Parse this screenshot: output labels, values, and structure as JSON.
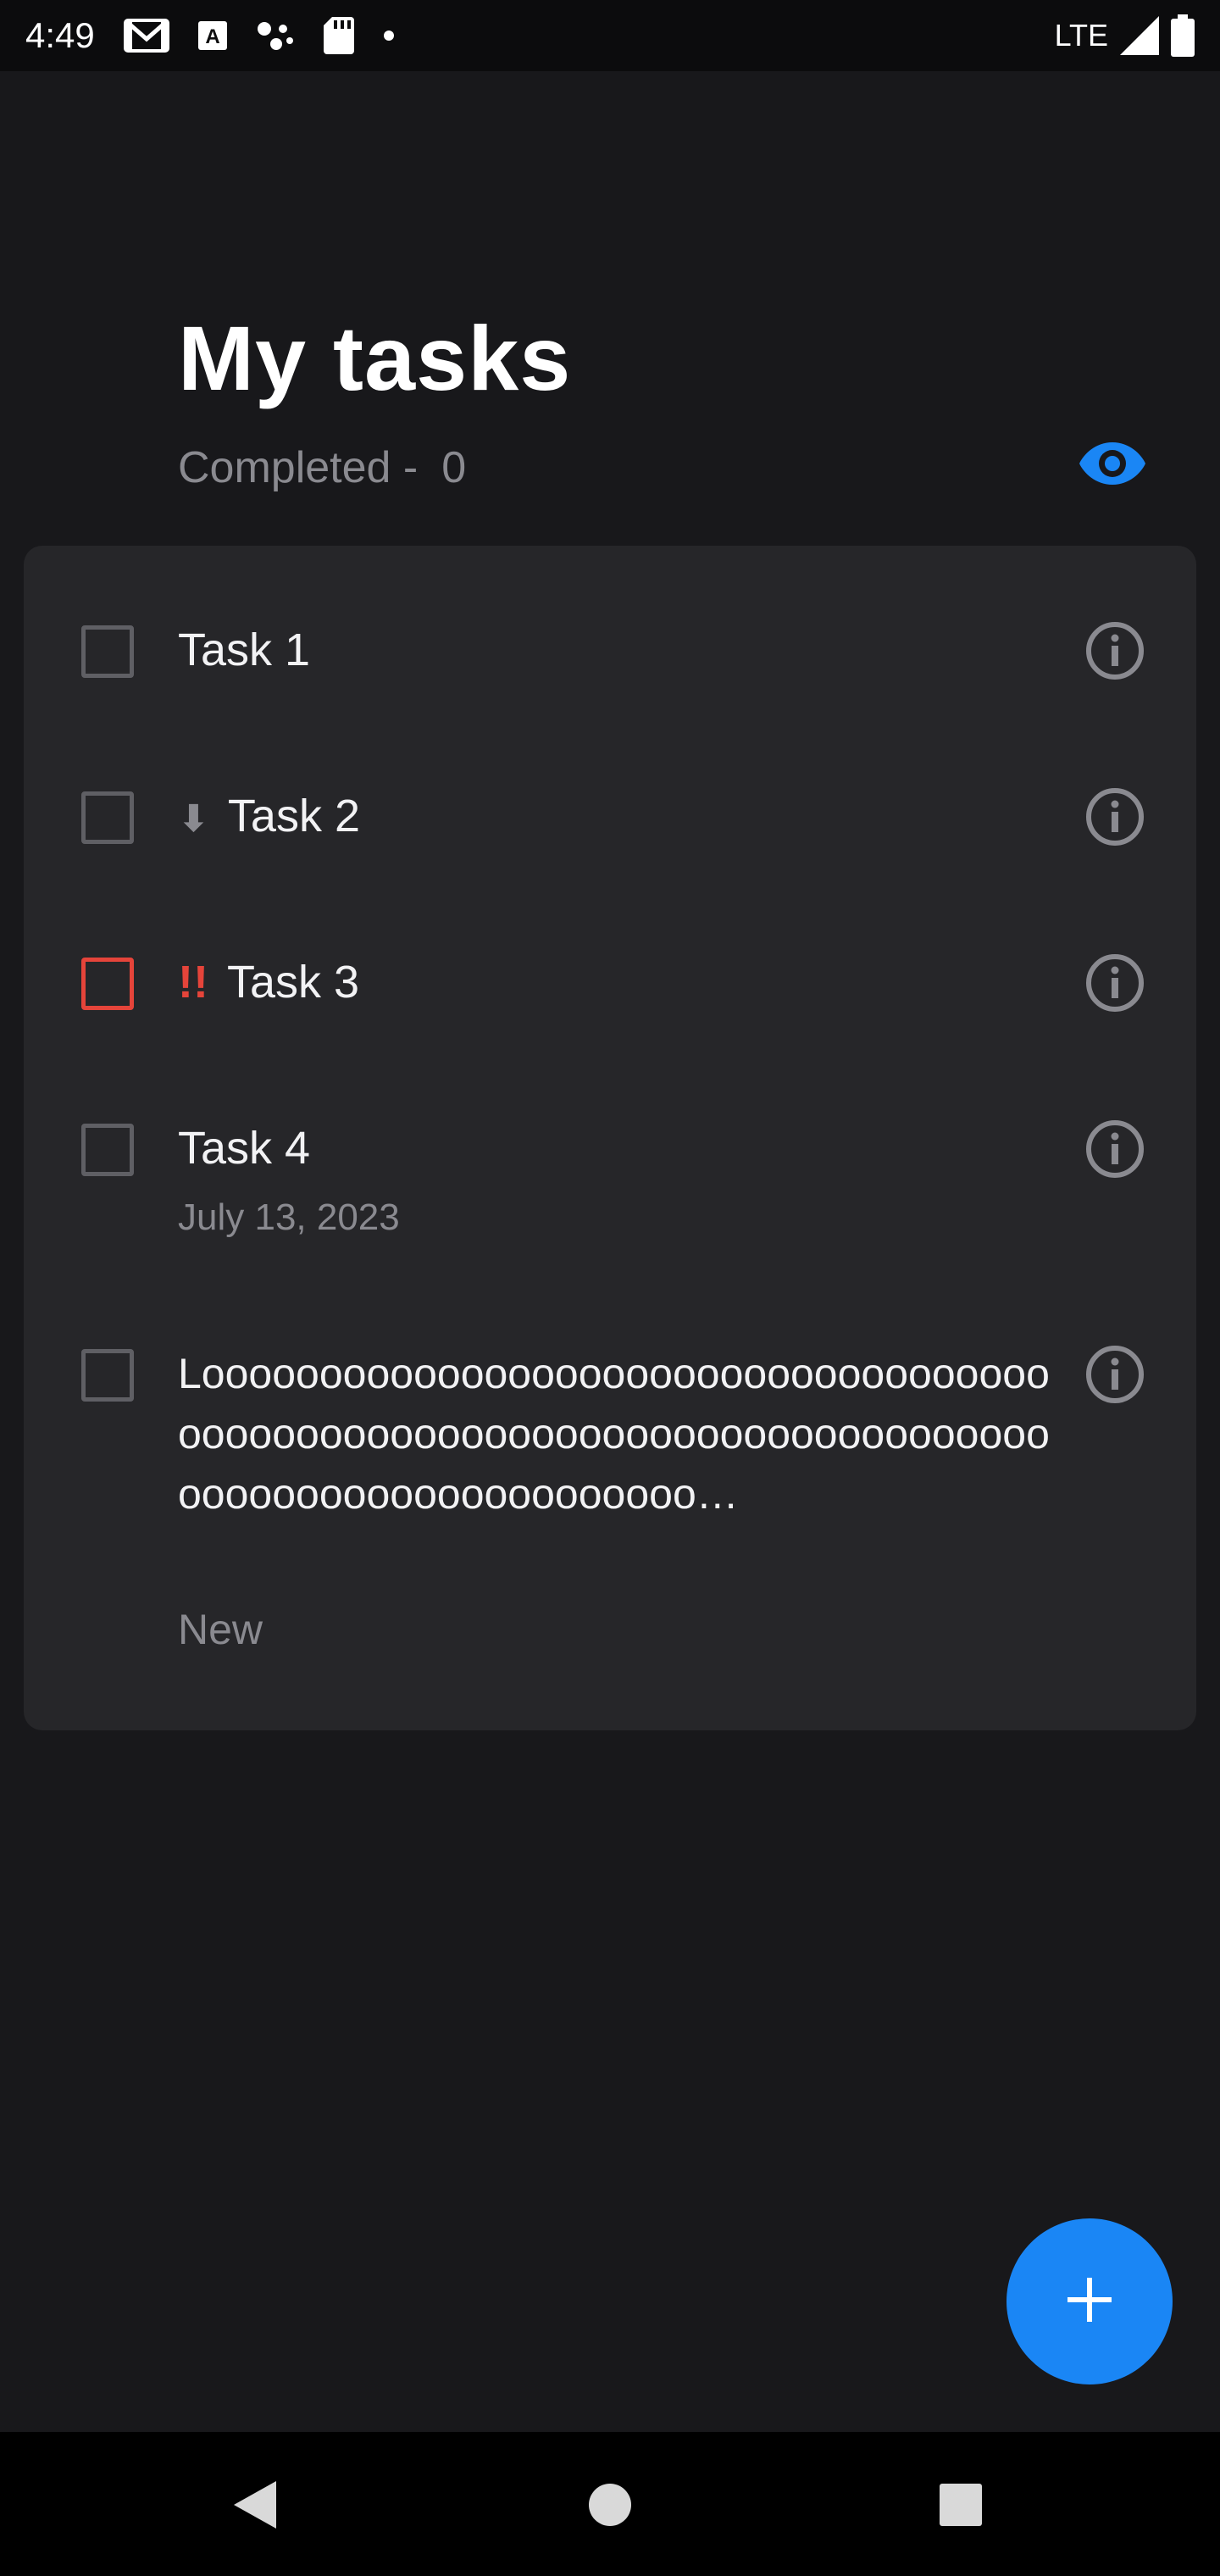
{
  "status_bar": {
    "time": "4:49",
    "network": "LTE",
    "icons": [
      "gmail-icon",
      "font-app-icon",
      "assistant-dots-icon",
      "sd-card-icon",
      "notification-dot-icon",
      "signal-icon",
      "battery-icon"
    ]
  },
  "header": {
    "title": "My tasks",
    "completed_label": "Completed -",
    "completed_count": "0"
  },
  "tasks": [
    {
      "title": "Task 1",
      "priority": "",
      "date": "",
      "checked": false
    },
    {
      "title": "Task 2",
      "priority": "low",
      "priority_glyph": "⬇",
      "date": "",
      "checked": false
    },
    {
      "title": "Task 3",
      "priority": "high",
      "priority_glyph": "!!",
      "date": "",
      "checked": false
    },
    {
      "title": "Task 4",
      "priority": "",
      "date": "July 13, 2023",
      "checked": false
    },
    {
      "title": "Looooooooooooooooooooooooooooooooooooooooooooooooooooooooooooooooooooooooooooooooooooooooooooooo…",
      "priority": "",
      "date": "",
      "checked": false
    }
  ],
  "new_item_label": "New",
  "colors": {
    "accent": "#1a86f5",
    "high_priority": "#e5443a",
    "background": "#18181b",
    "card": "#262629"
  }
}
